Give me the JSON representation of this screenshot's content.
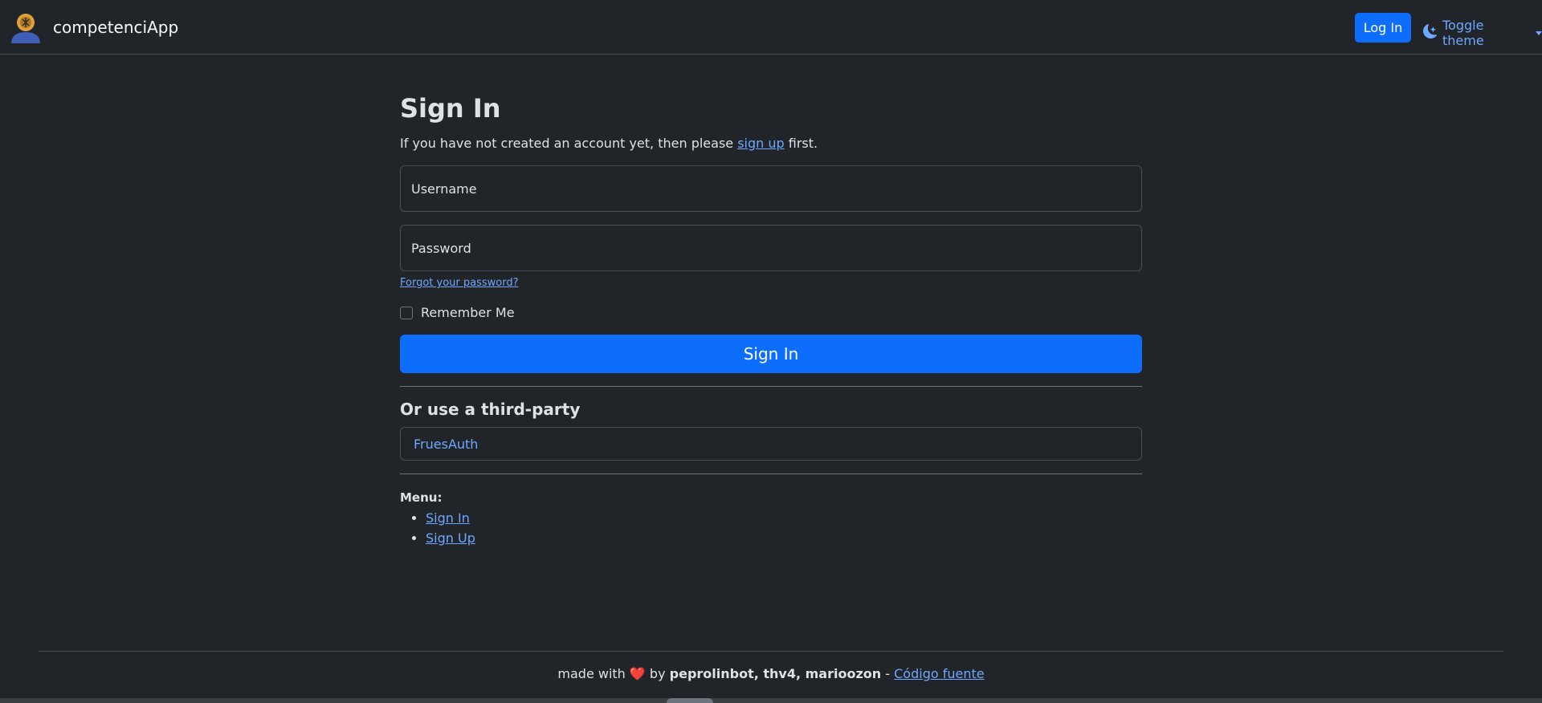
{
  "navbar": {
    "brand": "competenciApp",
    "login_label": "Log In",
    "theme_label": "Toggle theme"
  },
  "signin": {
    "title": "Sign In",
    "intro_before": "If you have not created an account yet, then please ",
    "intro_link": "sign up",
    "intro_after": " first.",
    "username_placeholder": "Username",
    "password_placeholder": "Password",
    "forgot_label": "Forgot your password?",
    "remember_label": "Remember Me",
    "remember_checked": false,
    "submit_label": "Sign In"
  },
  "third_party": {
    "title": "Or use a third-party",
    "providers": [
      "FruesAuth"
    ]
  },
  "menu": {
    "title": "Menu:",
    "items": [
      "Sign In",
      "Sign Up"
    ]
  },
  "footer": {
    "made_with": "made with",
    "heart": "❤️",
    "by": "by",
    "authors": "peprolinbot, thv4, marioozon",
    "dash": "-",
    "source_label": "Código fuente"
  },
  "colors": {
    "background": "#212529",
    "primary": "#0d6efd",
    "link": "#6ea8fe",
    "text": "#dee2e6"
  },
  "icons": {
    "avatar": "user-avatar-icon",
    "theme": "moon-icon"
  }
}
